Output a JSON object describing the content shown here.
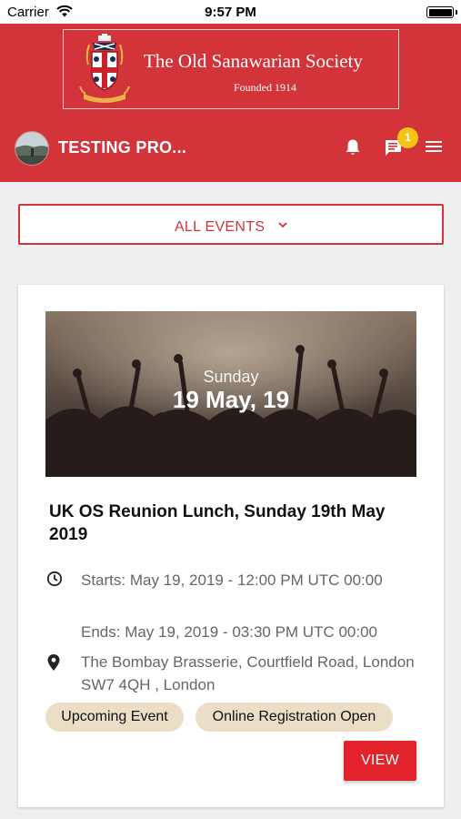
{
  "status_bar": {
    "carrier": "Carrier",
    "time": "9:57 PM"
  },
  "header": {
    "society_name": "The Old Sanawarian Society",
    "founded": "Founded 1914",
    "username": "TESTING PRO...",
    "notification_count": "1",
    "brand_color": "#d33439"
  },
  "filter": {
    "label": "ALL EVENTS"
  },
  "event": {
    "image_day": "Sunday",
    "image_date": "19 May, 19",
    "title": "UK OS Reunion Lunch, Sunday 19th May 2019",
    "starts": "Starts: May 19, 2019 - 12:00 PM UTC 00:00",
    "ends": "Ends: May 19, 2019 - 03:30 PM UTC 00:00",
    "address": "The Bombay Brasserie, Courtfield Road, London SW7 4QH , London",
    "tags": [
      "Upcoming Event",
      "Online Registration Open"
    ],
    "view_label": "VIEW"
  },
  "icons": {
    "wifi": "wifi-icon",
    "battery": "battery-icon",
    "bell": "bell-icon",
    "chat": "chat-icon",
    "menu": "hamburger-menu-icon",
    "chevron": "chevron-down-icon",
    "clock": "clock-icon",
    "pin": "location-pin-icon"
  }
}
